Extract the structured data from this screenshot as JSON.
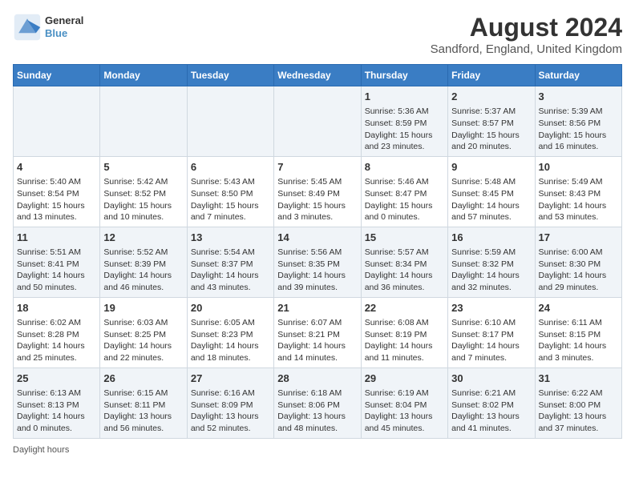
{
  "header": {
    "logo_line1": "General",
    "logo_line2": "Blue",
    "main_title": "August 2024",
    "subtitle": "Sandford, England, United Kingdom"
  },
  "days_of_week": [
    "Sunday",
    "Monday",
    "Tuesday",
    "Wednesday",
    "Thursday",
    "Friday",
    "Saturday"
  ],
  "footer": "Daylight hours",
  "weeks": [
    [
      {
        "day": "",
        "info": ""
      },
      {
        "day": "",
        "info": ""
      },
      {
        "day": "",
        "info": ""
      },
      {
        "day": "",
        "info": ""
      },
      {
        "day": "1",
        "info": "Sunrise: 5:36 AM\nSunset: 8:59 PM\nDaylight: 15 hours\nand 23 minutes."
      },
      {
        "day": "2",
        "info": "Sunrise: 5:37 AM\nSunset: 8:57 PM\nDaylight: 15 hours\nand 20 minutes."
      },
      {
        "day": "3",
        "info": "Sunrise: 5:39 AM\nSunset: 8:56 PM\nDaylight: 15 hours\nand 16 minutes."
      }
    ],
    [
      {
        "day": "4",
        "info": "Sunrise: 5:40 AM\nSunset: 8:54 PM\nDaylight: 15 hours\nand 13 minutes."
      },
      {
        "day": "5",
        "info": "Sunrise: 5:42 AM\nSunset: 8:52 PM\nDaylight: 15 hours\nand 10 minutes."
      },
      {
        "day": "6",
        "info": "Sunrise: 5:43 AM\nSunset: 8:50 PM\nDaylight: 15 hours\nand 7 minutes."
      },
      {
        "day": "7",
        "info": "Sunrise: 5:45 AM\nSunset: 8:49 PM\nDaylight: 15 hours\nand 3 minutes."
      },
      {
        "day": "8",
        "info": "Sunrise: 5:46 AM\nSunset: 8:47 PM\nDaylight: 15 hours\nand 0 minutes."
      },
      {
        "day": "9",
        "info": "Sunrise: 5:48 AM\nSunset: 8:45 PM\nDaylight: 14 hours\nand 57 minutes."
      },
      {
        "day": "10",
        "info": "Sunrise: 5:49 AM\nSunset: 8:43 PM\nDaylight: 14 hours\nand 53 minutes."
      }
    ],
    [
      {
        "day": "11",
        "info": "Sunrise: 5:51 AM\nSunset: 8:41 PM\nDaylight: 14 hours\nand 50 minutes."
      },
      {
        "day": "12",
        "info": "Sunrise: 5:52 AM\nSunset: 8:39 PM\nDaylight: 14 hours\nand 46 minutes."
      },
      {
        "day": "13",
        "info": "Sunrise: 5:54 AM\nSunset: 8:37 PM\nDaylight: 14 hours\nand 43 minutes."
      },
      {
        "day": "14",
        "info": "Sunrise: 5:56 AM\nSunset: 8:35 PM\nDaylight: 14 hours\nand 39 minutes."
      },
      {
        "day": "15",
        "info": "Sunrise: 5:57 AM\nSunset: 8:34 PM\nDaylight: 14 hours\nand 36 minutes."
      },
      {
        "day": "16",
        "info": "Sunrise: 5:59 AM\nSunset: 8:32 PM\nDaylight: 14 hours\nand 32 minutes."
      },
      {
        "day": "17",
        "info": "Sunrise: 6:00 AM\nSunset: 8:30 PM\nDaylight: 14 hours\nand 29 minutes."
      }
    ],
    [
      {
        "day": "18",
        "info": "Sunrise: 6:02 AM\nSunset: 8:28 PM\nDaylight: 14 hours\nand 25 minutes."
      },
      {
        "day": "19",
        "info": "Sunrise: 6:03 AM\nSunset: 8:25 PM\nDaylight: 14 hours\nand 22 minutes."
      },
      {
        "day": "20",
        "info": "Sunrise: 6:05 AM\nSunset: 8:23 PM\nDaylight: 14 hours\nand 18 minutes."
      },
      {
        "day": "21",
        "info": "Sunrise: 6:07 AM\nSunset: 8:21 PM\nDaylight: 14 hours\nand 14 minutes."
      },
      {
        "day": "22",
        "info": "Sunrise: 6:08 AM\nSunset: 8:19 PM\nDaylight: 14 hours\nand 11 minutes."
      },
      {
        "day": "23",
        "info": "Sunrise: 6:10 AM\nSunset: 8:17 PM\nDaylight: 14 hours\nand 7 minutes."
      },
      {
        "day": "24",
        "info": "Sunrise: 6:11 AM\nSunset: 8:15 PM\nDaylight: 14 hours\nand 3 minutes."
      }
    ],
    [
      {
        "day": "25",
        "info": "Sunrise: 6:13 AM\nSunset: 8:13 PM\nDaylight: 14 hours\nand 0 minutes."
      },
      {
        "day": "26",
        "info": "Sunrise: 6:15 AM\nSunset: 8:11 PM\nDaylight: 13 hours\nand 56 minutes."
      },
      {
        "day": "27",
        "info": "Sunrise: 6:16 AM\nSunset: 8:09 PM\nDaylight: 13 hours\nand 52 minutes."
      },
      {
        "day": "28",
        "info": "Sunrise: 6:18 AM\nSunset: 8:06 PM\nDaylight: 13 hours\nand 48 minutes."
      },
      {
        "day": "29",
        "info": "Sunrise: 6:19 AM\nSunset: 8:04 PM\nDaylight: 13 hours\nand 45 minutes."
      },
      {
        "day": "30",
        "info": "Sunrise: 6:21 AM\nSunset: 8:02 PM\nDaylight: 13 hours\nand 41 minutes."
      },
      {
        "day": "31",
        "info": "Sunrise: 6:22 AM\nSunset: 8:00 PM\nDaylight: 13 hours\nand 37 minutes."
      }
    ]
  ]
}
